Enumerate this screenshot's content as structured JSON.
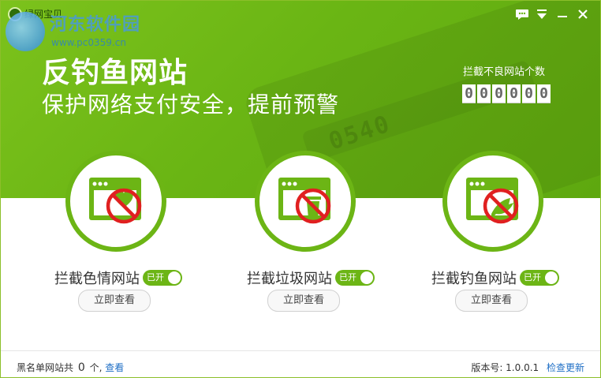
{
  "app": {
    "name": "绿网宝贝"
  },
  "watermark": {
    "text": "河东软件园",
    "url": "www.pc0359.cn"
  },
  "banner": {
    "headline": "反钓鱼网站",
    "subhead": "保护网络支付安全，提前预警",
    "counter_label": "拦截不良网站个数",
    "digits": [
      "0",
      "0",
      "0",
      "0",
      "0",
      "0"
    ],
    "card_number": "0540"
  },
  "features": [
    {
      "label": "拦截色情网站",
      "toggle": "已开",
      "button": "立即查看",
      "icon": "blocked-heart-icon"
    },
    {
      "label": "拦截垃圾网站",
      "toggle": "已开",
      "button": "立即查看",
      "icon": "blocked-trash-icon"
    },
    {
      "label": "拦截钓鱼网站",
      "toggle": "已开",
      "button": "立即查看",
      "icon": "blocked-fish-icon"
    }
  ],
  "footer": {
    "blacklist_prefix": "黑名单网站共",
    "blacklist_count": "0",
    "blacklist_suffix": "个,",
    "view_link": "查看",
    "version_label": "版本号: 1.0.0.1",
    "update_link": "检查更新"
  },
  "colors": {
    "accent": "#6cb515",
    "block_red": "#e02020",
    "link": "#1f6fc6"
  }
}
